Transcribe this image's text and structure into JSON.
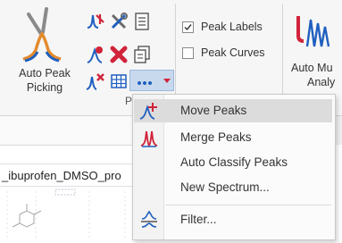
{
  "ribbon": {
    "auto_peak_picking": {
      "line1": "Auto Peak",
      "line2": "Picking"
    },
    "auto_multiplet": {
      "line1": "Auto Mu",
      "line2": "Analy"
    },
    "group_label": "P",
    "peak_labels": {
      "label": "Peak Labels",
      "checked": true
    },
    "peak_curves": {
      "label": "Peak Curves",
      "checked": false
    }
  },
  "document": {
    "title": "_ibuprofen_DMSO_pro"
  },
  "menu": {
    "items": [
      {
        "label": "Move Peaks",
        "icon": "move-peaks-icon",
        "highlighted": true
      },
      {
        "label": "Merge Peaks",
        "icon": "merge-peaks-icon",
        "highlighted": false
      },
      {
        "label": "Auto Classify Peaks",
        "icon": "",
        "highlighted": false
      },
      {
        "label": "New Spectrum...",
        "icon": "",
        "highlighted": false
      },
      {
        "label": "Filter...",
        "icon": "filter-icon",
        "highlighted": false
      }
    ]
  },
  "colors": {
    "accent_blue": "#1f5fbf",
    "accent_red": "#d0243a",
    "menu_highlight": "#dcdcdc"
  }
}
